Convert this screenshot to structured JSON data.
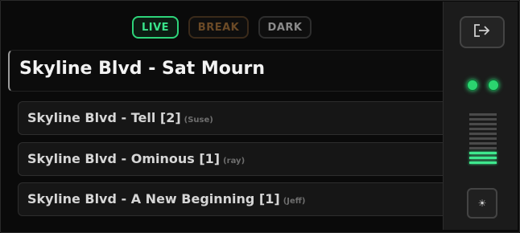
{
  "modes": {
    "live": "LIVE",
    "break": "BREAK",
    "dark": "DARK",
    "selected": "LIVE"
  },
  "current": {
    "title": "Skyline Blvd - Sat Mourn"
  },
  "queue": [
    {
      "title": "Skyline Blvd - Tell [2]",
      "author": "(Suse)"
    },
    {
      "title": "Skyline Blvd - Ominous [1]",
      "author": "(ray)"
    },
    {
      "title": "Skyline Blvd - A New Beginning [1]",
      "author": "(Jeff)"
    }
  ],
  "side": {
    "exit_icon": "exit-icon",
    "brightness_icon": "brightness-icon",
    "brightness_glyph": "☀",
    "status_leds": [
      "on",
      "on"
    ],
    "meter_level": 0.3
  },
  "colors": {
    "live": "#39e38a",
    "break": "#6b4a26",
    "dark": "#8a8a8a",
    "meter_on": "#3ee88e"
  }
}
